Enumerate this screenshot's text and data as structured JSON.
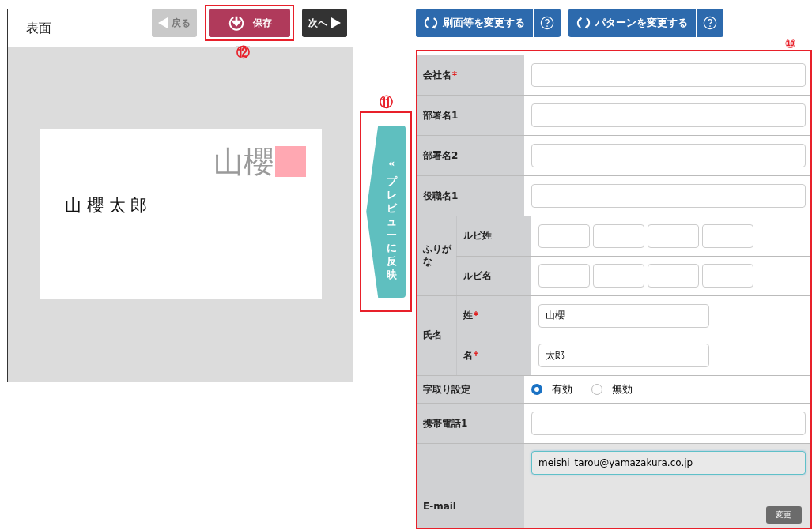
{
  "tabs": [
    {
      "label": "表面",
      "selected": true
    }
  ],
  "nav_buttons": [
    {
      "kind": "back",
      "label": "戻る",
      "disabled": true
    },
    {
      "kind": "save",
      "label": "保存",
      "disabled": false,
      "callout": "⑫"
    },
    {
      "kind": "next",
      "label": "次へ",
      "disabled": false
    }
  ],
  "preview": {
    "logo_text": "山櫻",
    "name": "山 櫻 太 郎"
  },
  "reflect_button": {
    "icon": "«",
    "label": "プレビューに反映",
    "callout": "⑪"
  },
  "change_buttons": [
    {
      "label": "刷面等を変更する"
    },
    {
      "label": "パターンを変更する"
    }
  ],
  "form": {
    "callout": "⑩",
    "rows": [
      {
        "kind": "text",
        "label": "会社名",
        "required": true
      },
      {
        "kind": "text",
        "label": "部署名1",
        "required": false
      },
      {
        "kind": "text",
        "label": "部署名2",
        "required": false
      },
      {
        "kind": "text",
        "label": "役職名1",
        "required": false
      },
      {
        "kind": "group",
        "label": "ふりがな",
        "children": [
          {
            "kind": "ruby",
            "label": "ルビ姓",
            "required": false
          },
          {
            "kind": "ruby",
            "label": "ルビ名",
            "required": false
          }
        ]
      },
      {
        "kind": "group",
        "label": "氏名",
        "children": [
          {
            "kind": "short",
            "label": "姓",
            "required": true,
            "value": "山櫻"
          },
          {
            "kind": "short",
            "label": "名",
            "required": true,
            "value": "太郎"
          }
        ]
      },
      {
        "kind": "radio",
        "label": "字取り設定",
        "options": [
          {
            "label": "有効",
            "selected": true
          },
          {
            "label": "無効",
            "selected": false
          }
        ]
      },
      {
        "kind": "text",
        "label": "携帯電話1",
        "required": false
      },
      {
        "kind": "email",
        "label": "E-mail",
        "value": "meishi_tarou@yamazakura.co.jp",
        "button": "変更"
      }
    ]
  }
}
